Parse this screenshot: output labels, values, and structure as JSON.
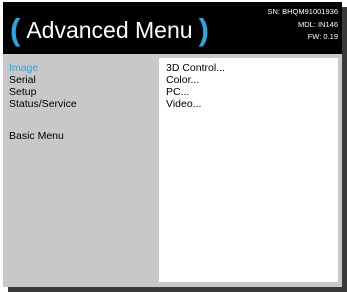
{
  "header": {
    "paren_open": "(",
    "title": "Advanced Menu",
    "paren_close": ")",
    "serial_number": "SN: BHQM91001936",
    "model": "MDL: IN146",
    "firmware": "FW: 0.19"
  },
  "sidebar": {
    "items": [
      {
        "label": "Image",
        "active": true
      },
      {
        "label": "Serial",
        "active": false
      },
      {
        "label": "Setup",
        "active": false
      },
      {
        "label": "Status/Service",
        "active": false
      },
      {
        "label": "Basic Menu",
        "active": false
      }
    ]
  },
  "content": {
    "items": [
      {
        "label": "3D Control..."
      },
      {
        "label": "Color..."
      },
      {
        "label": "PC..."
      },
      {
        "label": "Video..."
      }
    ]
  },
  "colors": {
    "accent": "#29a8e0",
    "header_bg": "#000000",
    "panel_bg": "#c8c8c8",
    "content_bg": "#ffffff"
  }
}
